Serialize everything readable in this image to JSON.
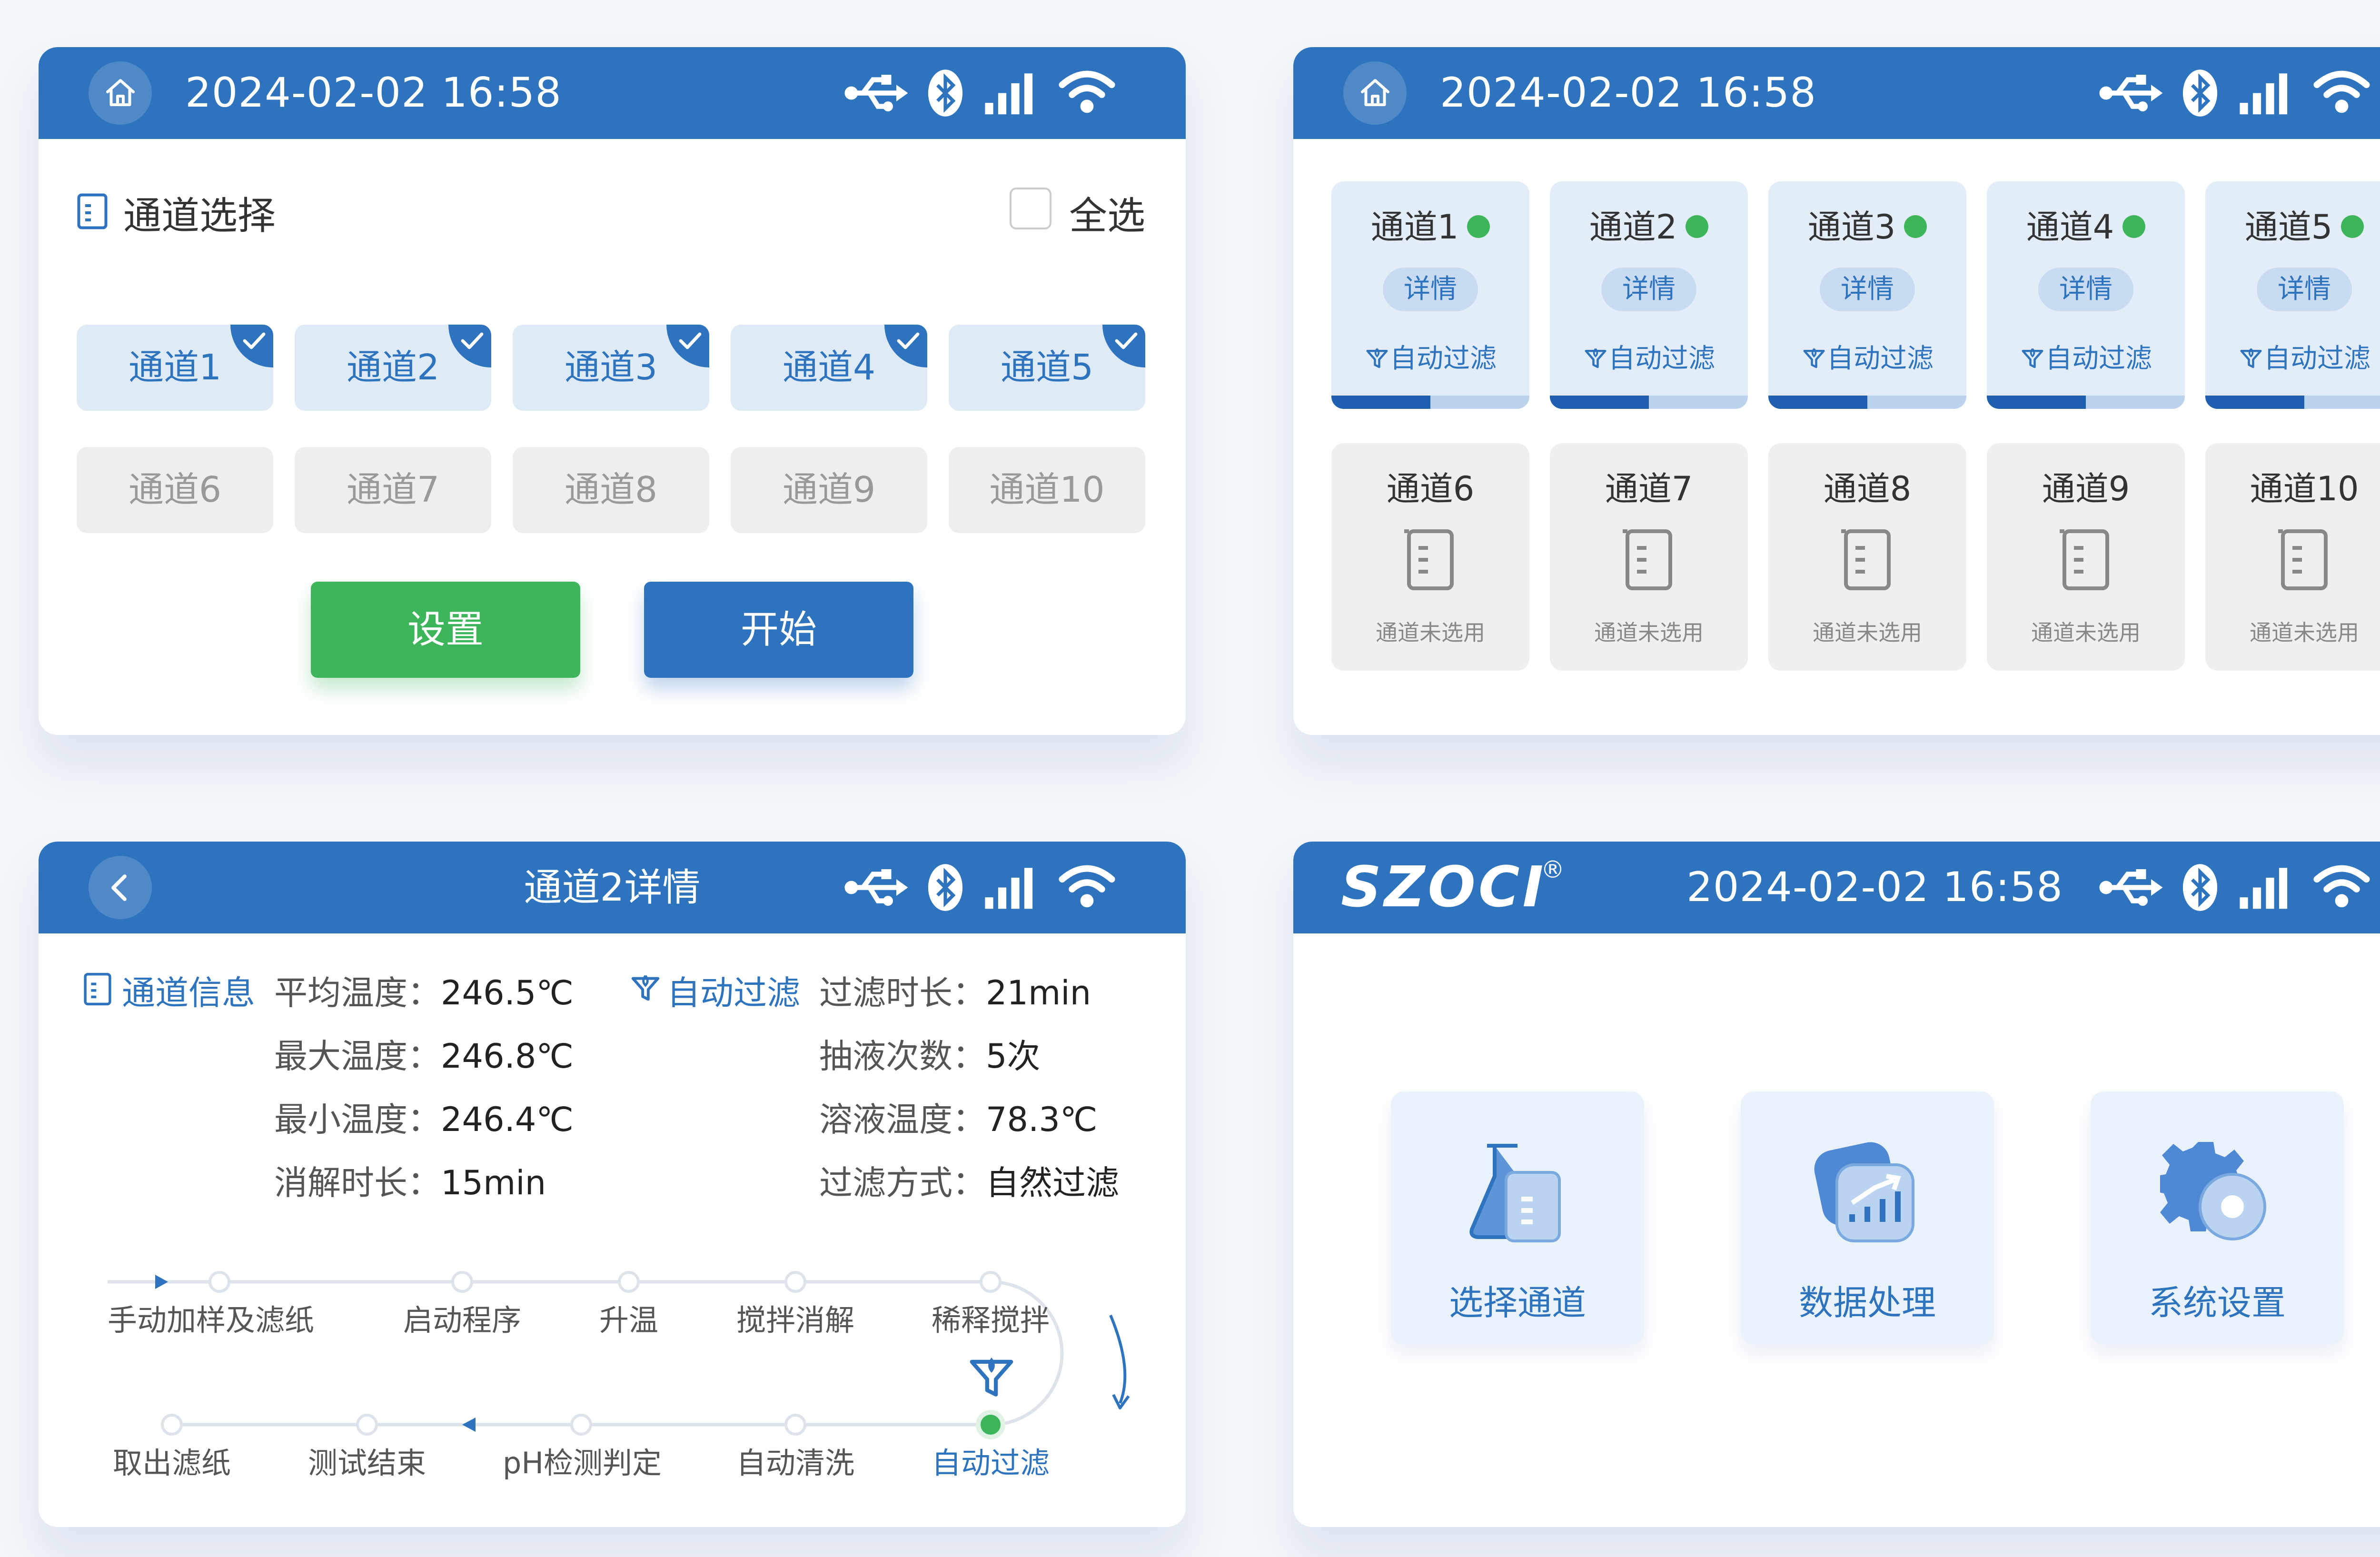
{
  "status_datetime": "2024-02-02 16:58",
  "status_icons": [
    "usb-icon",
    "bluetooth-icon",
    "signal-icon",
    "wifi-icon"
  ],
  "colors": {
    "primary": "#2e73be",
    "green": "#3db55a",
    "selected_bg": "#dfeaf7",
    "disabled_bg": "#eeeeee"
  },
  "channel_select": {
    "title": "通道选择",
    "select_all": "全选",
    "channels": [
      {
        "label": "通道1",
        "selected": true
      },
      {
        "label": "通道2",
        "selected": true
      },
      {
        "label": "通道3",
        "selected": true
      },
      {
        "label": "通道4",
        "selected": true
      },
      {
        "label": "通道5",
        "selected": true
      },
      {
        "label": "通道6",
        "selected": false
      },
      {
        "label": "通道7",
        "selected": false
      },
      {
        "label": "通道8",
        "selected": false
      },
      {
        "label": "通道9",
        "selected": false
      },
      {
        "label": "通道10",
        "selected": false
      }
    ],
    "settings_button": "设置",
    "start_button": "开始"
  },
  "channel_overview": {
    "active": [
      {
        "name": "通道1",
        "detail": "详情",
        "status": "自动过滤",
        "progress": 0.5
      },
      {
        "name": "通道2",
        "detail": "详情",
        "status": "自动过滤",
        "progress": 0.5
      },
      {
        "name": "通道3",
        "detail": "详情",
        "status": "自动过滤",
        "progress": 0.5
      },
      {
        "name": "通道4",
        "detail": "详情",
        "status": "自动过滤",
        "progress": 0.5
      },
      {
        "name": "通道5",
        "detail": "详情",
        "status": "自动过滤",
        "progress": 0.5
      }
    ],
    "inactive": [
      {
        "name": "通道6",
        "note": "通道未选用"
      },
      {
        "name": "通道7",
        "note": "通道未选用"
      },
      {
        "name": "通道8",
        "note": "通道未选用"
      },
      {
        "name": "通道9",
        "note": "通道未选用"
      },
      {
        "name": "通道10",
        "note": "通道未选用"
      }
    ]
  },
  "channel_detail": {
    "title": "通道2详情",
    "info_label": "通道信息",
    "left": [
      {
        "key": "平均温度：",
        "value": "246.5℃"
      },
      {
        "key": "最大温度：",
        "value": "246.8℃"
      },
      {
        "key": "最小温度：",
        "value": "246.4℃"
      },
      {
        "key": "消解时长：",
        "value": "15min"
      }
    ],
    "mode_label": "自动过滤",
    "right": [
      {
        "key": "过滤时长：",
        "value": "21min"
      },
      {
        "key": "抽液次数：",
        "value": "5次"
      },
      {
        "key": "溶液温度：",
        "value": "78.3℃"
      },
      {
        "key": "过滤方式：",
        "value": "自然过滤"
      }
    ],
    "steps_row1": [
      "手动加样及滤纸",
      "启动程序",
      "升温",
      "搅拌消解",
      "稀释搅拌"
    ],
    "steps_row2": [
      "取出滤纸",
      "测试结束",
      "pH检测判定",
      "自动清洗",
      "自动过滤"
    ],
    "current_step": "自动过滤"
  },
  "home": {
    "logo": "SZOCI",
    "logo_mark": "®",
    "tiles": [
      {
        "label": "选择通道",
        "icon": "flask-icon"
      },
      {
        "label": "数据处理",
        "icon": "chart-icon"
      },
      {
        "label": "系统设置",
        "icon": "gear-icon"
      }
    ]
  }
}
